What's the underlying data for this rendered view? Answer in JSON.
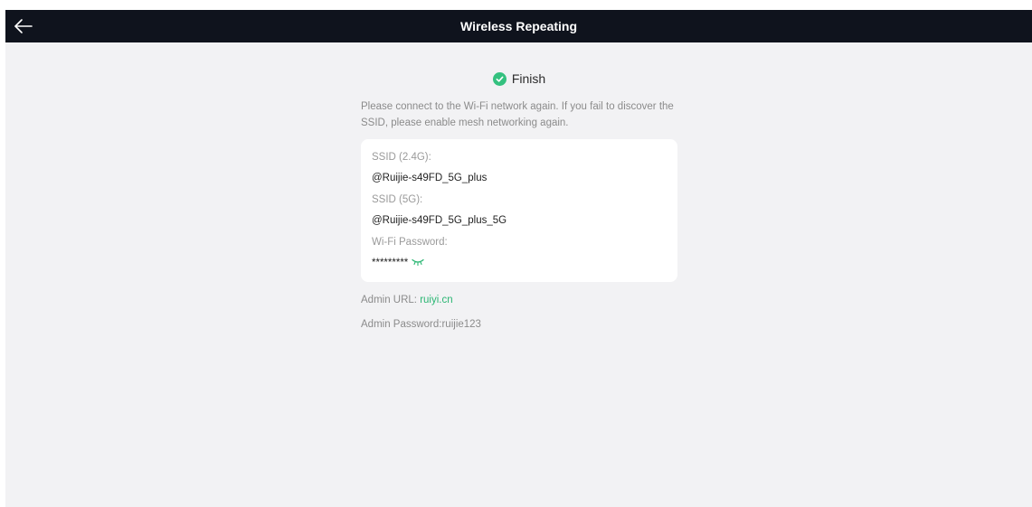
{
  "header": {
    "title": "Wireless Repeating",
    "back_icon": "arrow-left-icon"
  },
  "status": {
    "icon": "check-circle-icon",
    "label": "Finish",
    "color": "#34c17f"
  },
  "description": "Please connect to the Wi-Fi network again. If you fail to discover the SSID, please enable mesh networking again.",
  "wifi": {
    "ssid_24g_label": "SSID (2.4G):",
    "ssid_24g_value": "@Ruijie-s49FD_5G_plus",
    "ssid_5g_label": "SSID (5G):",
    "ssid_5g_value": "@Ruijie-s49FD_5G_plus_5G",
    "password_label": "Wi-Fi Password:",
    "password_value": "*********",
    "password_toggle_icon": "eye-closed-icon"
  },
  "admin": {
    "url_label": "Admin URL: ",
    "url_value": "ruiyi.cn",
    "password_text": "Admin Password:ruijie123"
  },
  "colors": {
    "header_bg": "#0f131d",
    "accent": "#2bb673",
    "page_bg": "#f2f2f4"
  }
}
